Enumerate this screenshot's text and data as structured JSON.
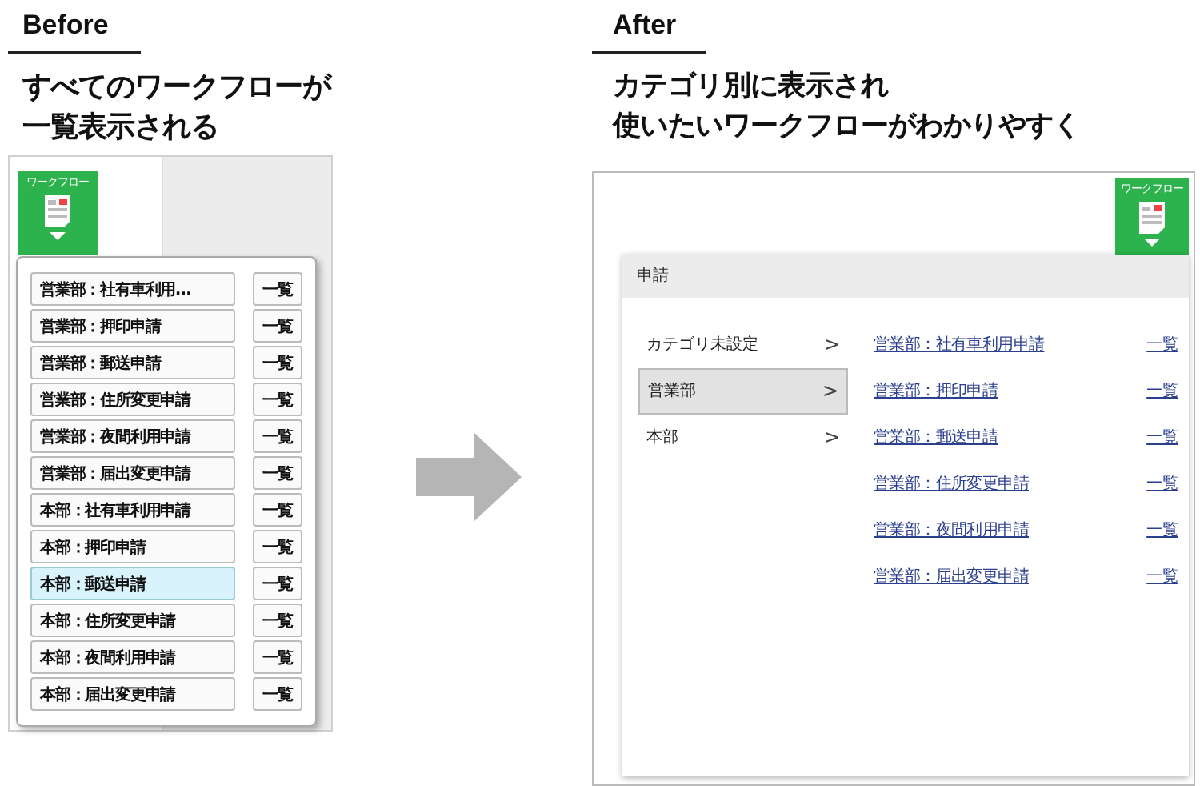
{
  "before": {
    "heading": "Before",
    "caption": [
      "すべてのワークフローが",
      "一覧表示される"
    ],
    "screenshot": {
      "workflow_button": {
        "label": "ワークフロー"
      },
      "items": [
        {
          "label": "営業部：社有車利用…",
          "list_button": "一覧",
          "selected": false
        },
        {
          "label": "営業部：押印申請",
          "list_button": "一覧",
          "selected": false
        },
        {
          "label": "営業部：郵送申請",
          "list_button": "一覧",
          "selected": false
        },
        {
          "label": "営業部：住所変更申請",
          "list_button": "一覧",
          "selected": false
        },
        {
          "label": "営業部：夜間利用申請",
          "list_button": "一覧",
          "selected": false
        },
        {
          "label": "営業部：届出変更申請",
          "list_button": "一覧",
          "selected": false
        },
        {
          "label": "本部：社有車利用申請",
          "list_button": "一覧",
          "selected": false
        },
        {
          "label": "本部：押印申請",
          "list_button": "一覧",
          "selected": false
        },
        {
          "label": "本部：郵送申請",
          "list_button": "一覧",
          "selected": true
        },
        {
          "label": "本部：住所変更申請",
          "list_button": "一覧",
          "selected": false
        },
        {
          "label": "本部：夜間利用申請",
          "list_button": "一覧",
          "selected": false
        },
        {
          "label": "本部：届出変更申請",
          "list_button": "一覧",
          "selected": false
        }
      ]
    }
  },
  "after": {
    "heading": "After",
    "caption": [
      "カテゴリ別に表示され",
      "使いたいワークフローがわかりやすく"
    ],
    "screenshot": {
      "workflow_button": {
        "label": "ワークフロー"
      },
      "panel_title": "申請",
      "categories": [
        {
          "label": "カテゴリ未設定",
          "chevron": ">",
          "selected": false
        },
        {
          "label": "営業部",
          "chevron": ">",
          "selected": true
        },
        {
          "label": "本部",
          "chevron": ">",
          "selected": false
        }
      ],
      "workflows": [
        {
          "label": "営業部：社有車利用申請",
          "list_link": "一覧"
        },
        {
          "label": "営業部：押印申請",
          "list_link": "一覧"
        },
        {
          "label": "営業部：郵送申請",
          "list_link": "一覧"
        },
        {
          "label": "営業部：住所変更申請",
          "list_link": "一覧"
        },
        {
          "label": "営業部：夜間利用申請",
          "list_link": "一覧"
        },
        {
          "label": "営業部：届出変更申請",
          "list_link": "一覧"
        }
      ]
    }
  }
}
